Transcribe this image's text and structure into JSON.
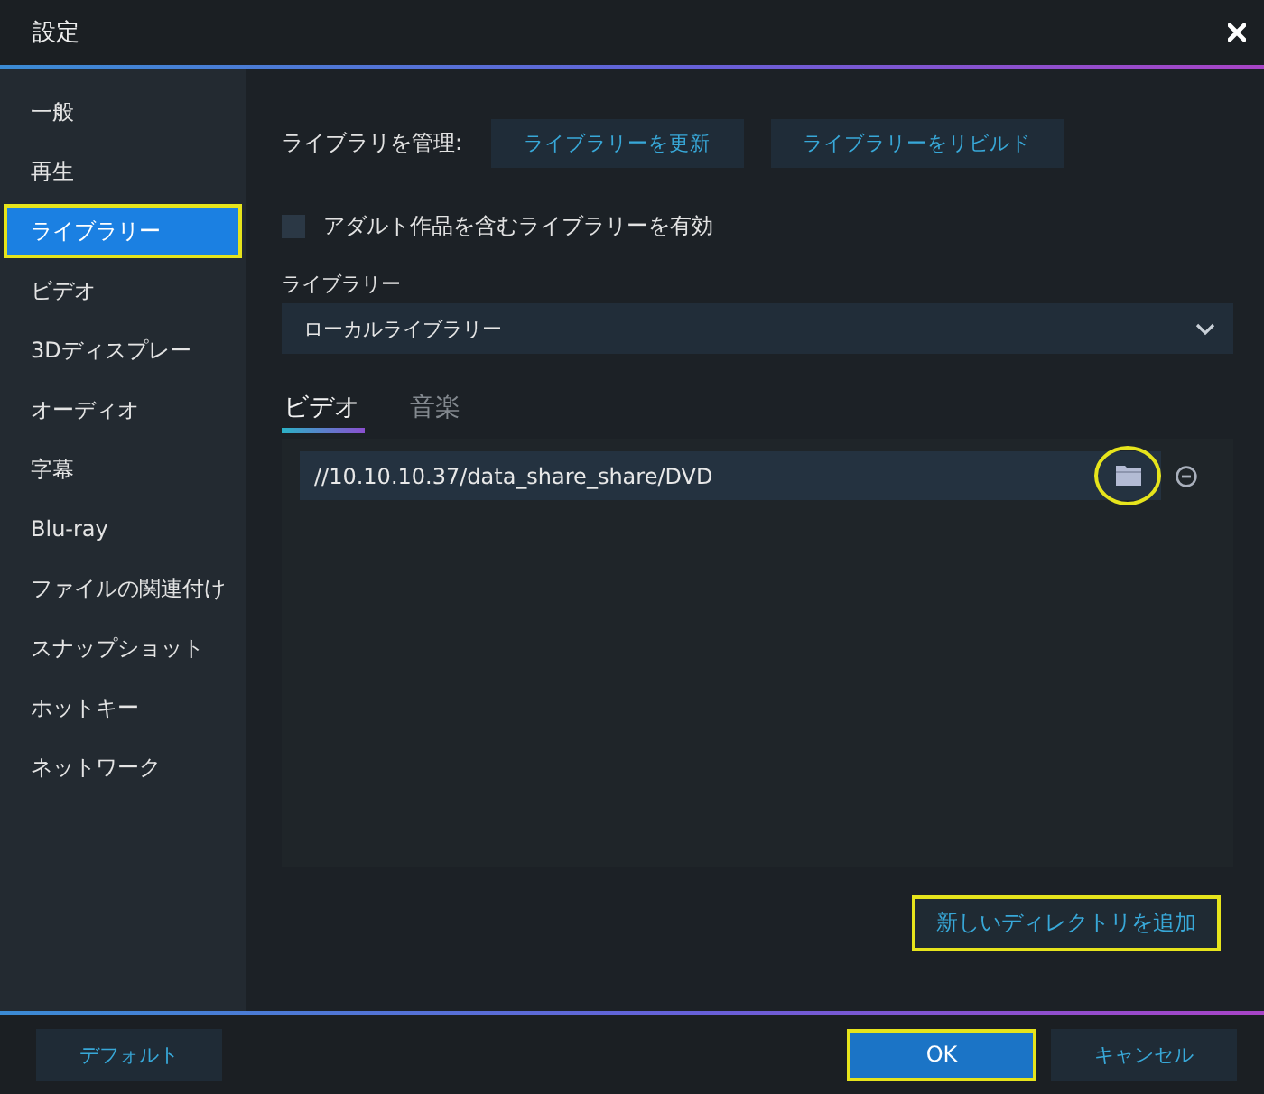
{
  "window": {
    "title": "設定"
  },
  "sidebar": {
    "items": [
      {
        "label": "一般",
        "selected": false,
        "highlighted": false
      },
      {
        "label": "再生",
        "selected": false,
        "highlighted": false
      },
      {
        "label": "ライブラリー",
        "selected": true,
        "highlighted": true
      },
      {
        "label": "ビデオ",
        "selected": false,
        "highlighted": false
      },
      {
        "label": "3Dディスプレー",
        "selected": false,
        "highlighted": false
      },
      {
        "label": "オーディオ",
        "selected": false,
        "highlighted": false
      },
      {
        "label": "字幕",
        "selected": false,
        "highlighted": false
      },
      {
        "label": "Blu-ray",
        "selected": false,
        "highlighted": false
      },
      {
        "label": "ファイルの関連付け",
        "selected": false,
        "highlighted": false
      },
      {
        "label": "スナップショット",
        "selected": false,
        "highlighted": false
      },
      {
        "label": "ホットキー",
        "selected": false,
        "highlighted": false
      },
      {
        "label": "ネットワーク",
        "selected": false,
        "highlighted": false
      }
    ]
  },
  "library": {
    "manage_label": "ライブラリを管理:",
    "buttons": [
      {
        "label": "ライブラリーを更新"
      },
      {
        "label": "ライブラリーをリビルド"
      }
    ],
    "adult_checkbox": {
      "label": "アダルト作品を含むライブラリーを有効",
      "checked": false
    },
    "library_label": "ライブラリー",
    "dropdown": {
      "value": "ローカルライブラリー"
    },
    "tabs": [
      {
        "label": "ビデオ",
        "selected": true
      },
      {
        "label": "音楽",
        "selected": false
      }
    ],
    "directories": [
      {
        "path": "//10.10.10.37/data_share_share/DVD",
        "folder_highlighted": true
      }
    ],
    "add_button": {
      "label": "新しいディレクトリを追加",
      "highlighted": true
    }
  },
  "footer": {
    "left_buttons": [
      {
        "label": "デフォルト",
        "kind": "plain",
        "highlighted": false
      }
    ],
    "right_buttons": [
      {
        "label": "OK",
        "kind": "primary",
        "highlighted": true
      },
      {
        "label": "キャンセル",
        "kind": "plain",
        "highlighted": false
      }
    ]
  }
}
